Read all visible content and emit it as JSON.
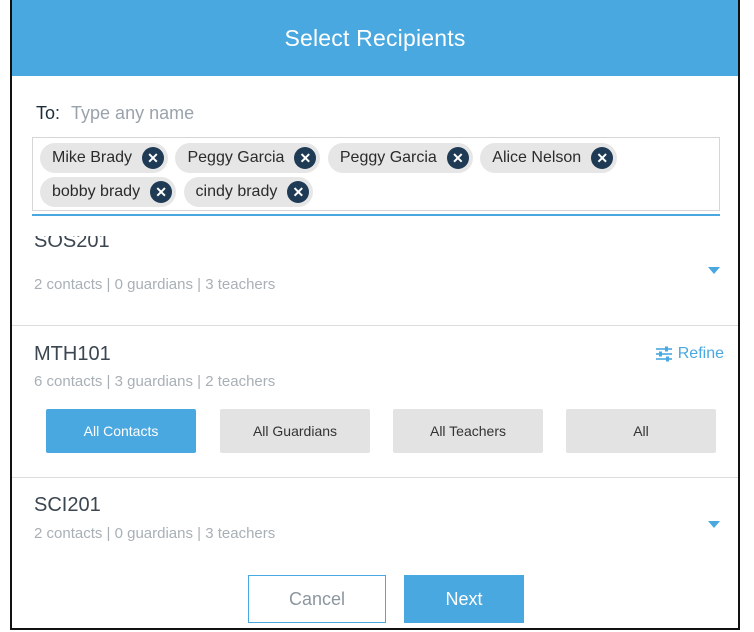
{
  "dialog": {
    "title": "Select Recipients"
  },
  "to": {
    "label": "To:",
    "placeholder": "Type any name"
  },
  "chips": [
    {
      "name": "Mike Brady"
    },
    {
      "name": "Peggy Garcia"
    },
    {
      "name": "Peggy Garcia"
    },
    {
      "name": "Alice Nelson"
    },
    {
      "name": "bobby brady"
    },
    {
      "name": "cindy brady"
    }
  ],
  "sections": [
    {
      "title": "SOS201",
      "subtitle": "2 contacts | 0 guardians | 3 teachers"
    },
    {
      "title": "MTH101",
      "subtitle": "6 contacts | 3 guardians | 2 teachers",
      "refine_label": "Refine",
      "filters": [
        "All Contacts",
        "All Guardians",
        "All Teachers",
        "All"
      ],
      "selected_filter": "All Contacts"
    },
    {
      "title": "SCI201",
      "subtitle": "2 contacts | 0 guardians | 3 teachers"
    }
  ],
  "footer": {
    "cancel_label": "Cancel",
    "next_label": "Next"
  },
  "colors": {
    "accent": "#4aa8e0",
    "chip_close": "#1e3a54",
    "chip_bg": "#e6e6e6"
  }
}
